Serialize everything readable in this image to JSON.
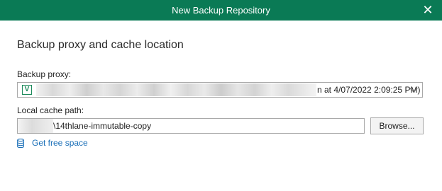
{
  "window": {
    "title": "New Backup Repository",
    "close_icon": "close-icon",
    "titlebar_color": "#0a7a55"
  },
  "main": {
    "heading": "Backup proxy and cache location",
    "backup_proxy": {
      "label": "Backup proxy:",
      "selected_value": "n at 4/07/2022 2:09:25 PM)",
      "icon": "server-icon"
    },
    "local_cache": {
      "label": "Local cache path:",
      "value": "\\14thlane-immutable-copy",
      "browse_label": "Browse..."
    },
    "free_space_link": {
      "label": "Get free space",
      "icon": "database-icon",
      "color": "#1a6fb8"
    }
  }
}
